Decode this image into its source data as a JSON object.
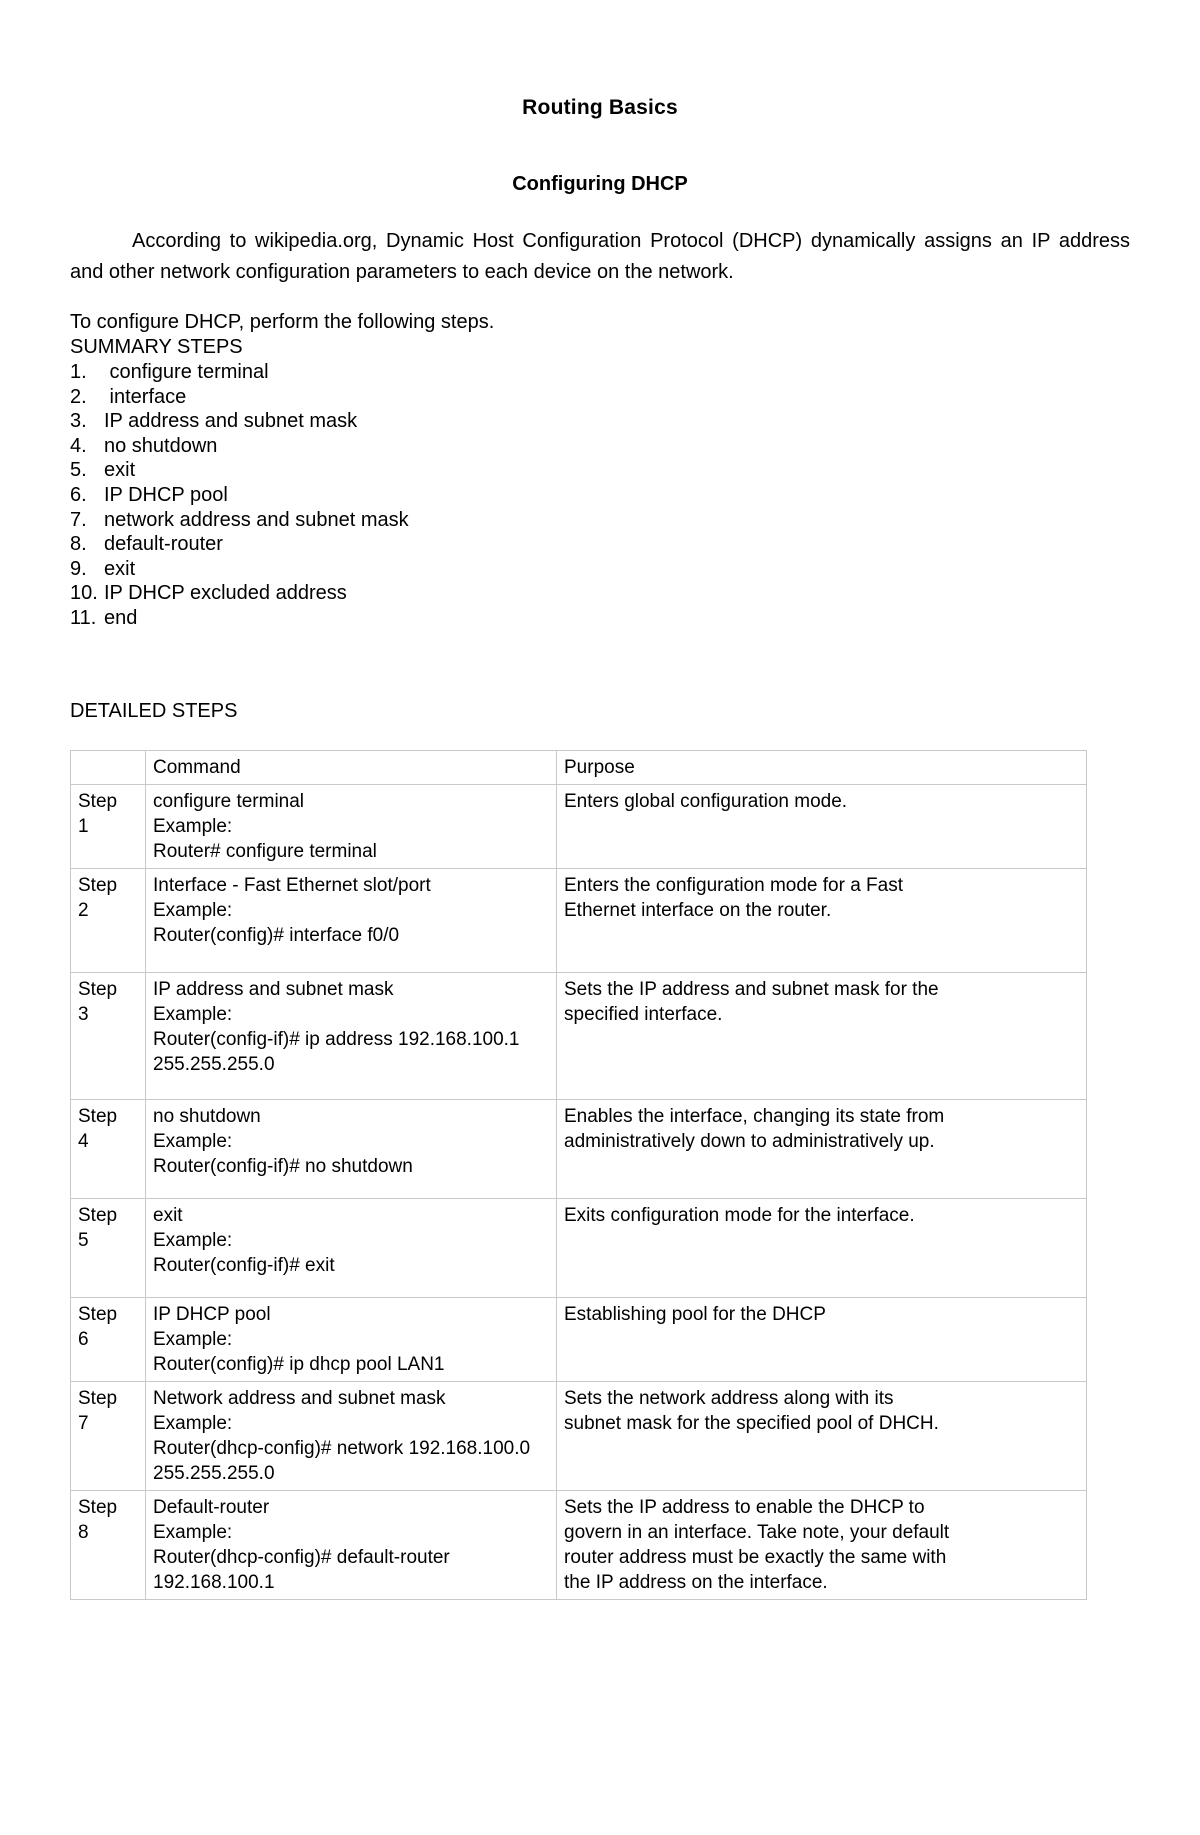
{
  "document": {
    "title": "Routing Basics",
    "section_title": "Configuring DHCP",
    "intro_paragraph": "According to wikipedia.org, Dynamic Host Configuration Protocol (DHCP) dynamically assigns an IP address and other network configuration parameters to each device on the network.",
    "lead_line": "To configure DHCP, perform the following steps.",
    "summary_label": "SUMMARY STEPS",
    "detailed_label": "DETAILED STEPS"
  },
  "summary_steps": [
    {
      "num": "1.",
      "text": " configure terminal"
    },
    {
      "num": "2.",
      "text": " interface"
    },
    {
      "num": "3.",
      "text": "IP address and subnet mask"
    },
    {
      "num": "4.",
      "text": "no shutdown"
    },
    {
      "num": "5.",
      "text": "exit"
    },
    {
      "num": "6.",
      "text": "IP DHCP pool"
    },
    {
      "num": "7.",
      "text": "network address and subnet mask"
    },
    {
      "num": "8.",
      "text": "default-router"
    },
    {
      "num": "9.",
      "text": "exit"
    },
    {
      "num": "10.",
      "text": "IP DHCP excluded address"
    },
    {
      "num": "11.",
      "text": "end"
    }
  ],
  "table": {
    "headers": {
      "step": "",
      "command": "Command",
      "purpose": "Purpose"
    },
    "rows": [
      {
        "step_word": "Step",
        "step_num": "1",
        "command": [
          "configure terminal",
          "Example:",
          "Router# configure terminal"
        ],
        "purpose": [
          "Enters global configuration mode."
        ]
      },
      {
        "step_word": "Step",
        "step_num": "2",
        "command": [
          "Interface - Fast Ethernet slot/port",
          "Example:",
          "Router(config)# interface f0/0"
        ],
        "purpose": [
          "Enters the configuration mode for a Fast",
          "Ethernet interface on the router."
        ]
      },
      {
        "step_word": "Step",
        "step_num": "3",
        "command": [
          "IP address and subnet mask",
          "Example:",
          "Router(config-if)# ip address 192.168.100.1",
          "255.255.255.0"
        ],
        "purpose": [
          "Sets the IP address and subnet mask for the",
          "specified interface."
        ]
      },
      {
        "step_word": "Step",
        "step_num": "4",
        "command": [
          "no shutdown",
          "Example:",
          "Router(config-if)# no shutdown"
        ],
        "purpose": [
          "Enables the interface, changing its state from",
          "administratively down to administratively up."
        ]
      },
      {
        "step_word": "Step",
        "step_num": "5",
        "command": [
          "exit",
          "Example:",
          "Router(config-if)# exit"
        ],
        "purpose": [
          "Exits configuration mode for the interface."
        ]
      },
      {
        "step_word": "Step",
        "step_num": "6",
        "command": [
          "IP DHCP pool",
          "Example:",
          "Router(config)# ip dhcp pool LAN1"
        ],
        "purpose": [
          "Establishing pool for the DHCP"
        ]
      },
      {
        "step_word": "Step",
        "step_num": "7",
        "command": [
          "Network address and subnet mask",
          "Example:",
          "Router(dhcp-config)# network 192.168.100.0",
          "255.255.255.0"
        ],
        "purpose": [
          "Sets the network address along with its",
          "subnet mask for the specified pool of DHCH."
        ]
      },
      {
        "step_word": "Step",
        "step_num": "8",
        "command": [
          "Default-router",
          "Example:",
          "Router(dhcp-config)# default-router",
          "192.168.100.1"
        ],
        "purpose": [
          "Sets the IP address to enable the DHCP to",
          "govern in an interface. Take note, your default",
          "router address must be exactly the same with",
          "the IP address on the interface."
        ]
      }
    ]
  },
  "colors": {
    "text": "#000000",
    "table_border": "#c9c9c9",
    "background": "#ffffff"
  }
}
